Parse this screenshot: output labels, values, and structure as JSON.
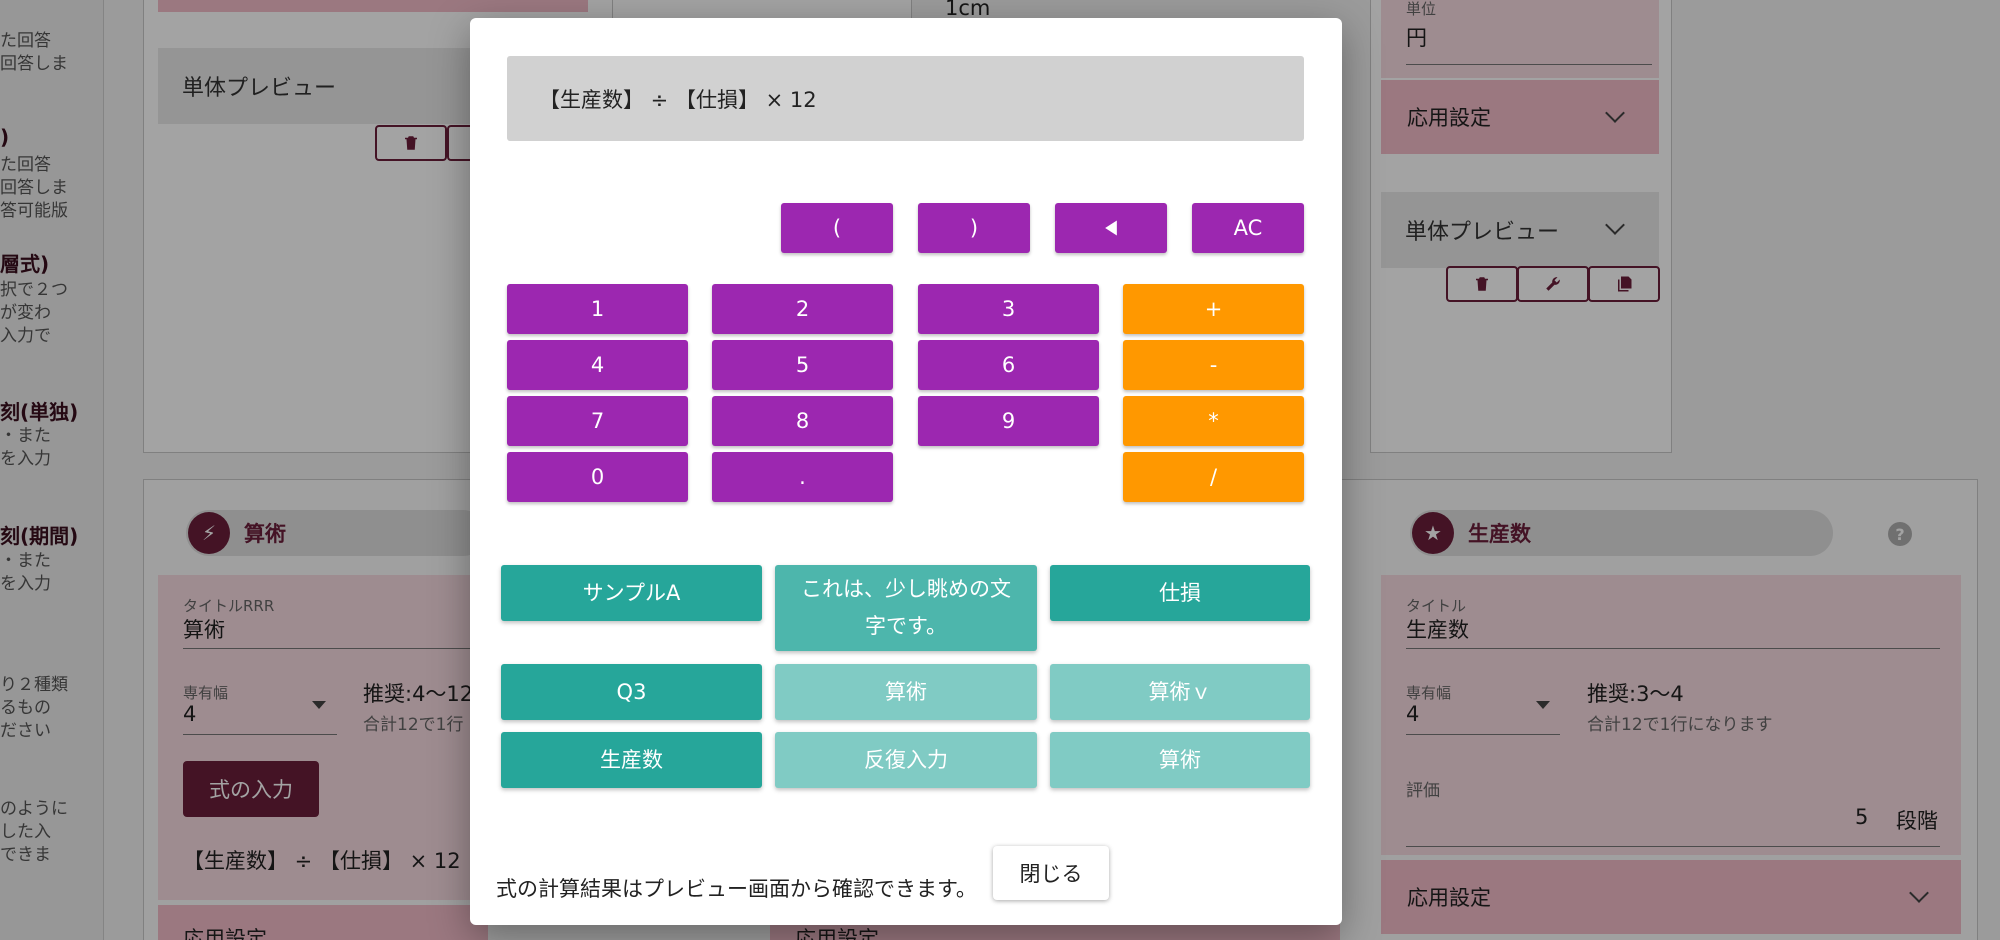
{
  "background": {
    "left_column": {
      "items": [
        {
          "line1": "た回答",
          "line2": "回答しま"
        },
        {
          "title": ")",
          "line1": "た回答",
          "line2": "回答しま",
          "line3": "答可能版"
        },
        {
          "title": "層式)",
          "line1": "択で２つ",
          "line2": "が変わ",
          "line3": "入力で"
        },
        {
          "title": "刻(単独)",
          "line1": "・また",
          "line2": "を入力"
        },
        {
          "title": "刻(期間)",
          "line1": "・また",
          "line2": "を入力"
        },
        {
          "line1": "り２種類",
          "line2": "るもの",
          "line3": "ださい"
        },
        {
          "line1": "のように",
          "line2": "した入",
          "line3": "できま"
        }
      ]
    },
    "top_left_panel": {
      "preview_label": "単体プレビュー"
    },
    "top_mid_panel": {
      "unit_text": "1cm"
    },
    "top_right_panel": {
      "unit_label": "単位",
      "unit_value": "円",
      "advanced_label": "応用設定",
      "preview_label": "単体プレビュー"
    },
    "arith_panel": {
      "header": "算術",
      "title_label": "タイトルRRR",
      "title_value": "算術",
      "width_label": "専有幅",
      "width_value": "4",
      "recommend": "推奨:4〜12",
      "recommend_note": "合計12で1行",
      "formula_button": "式の入力",
      "formula_text": "【生産数】 ÷ 【仕損】 × 12",
      "advanced_label": "応用設定"
    },
    "mid_bottom_panel": {
      "advanced_label": "応用設定"
    },
    "production_panel": {
      "header": "生産数",
      "title_label": "タイトル",
      "title_value": "生産数",
      "width_label": "専有幅",
      "width_value": "4",
      "recommend": "推奨:3〜4",
      "recommend_note": "合計12で1行になります",
      "rating_label": "評価",
      "rating_value": "5",
      "rating_unit": "段階",
      "advanced_label": "応用設定"
    }
  },
  "modal": {
    "display": "【生産数】 ÷ 【仕損】 × 12",
    "control_keys": [
      "(",
      ")",
      "AC"
    ],
    "number_keys": [
      "1",
      "2",
      "3",
      "4",
      "5",
      "6",
      "7",
      "8",
      "9",
      "0",
      "."
    ],
    "operator_keys": [
      "+",
      "-",
      "*",
      "/"
    ],
    "variables": [
      "サンプルA",
      "これは、少し眺めの文字です。",
      "仕損",
      "Q3",
      "算術",
      "算術ｖ",
      "生産数",
      "反復入力",
      "算術"
    ],
    "footer_note": "式の計算結果はプレビュー画面から確認できます。",
    "close_label": "閉じる"
  },
  "colors": {
    "key_purple": "#9c27b0",
    "key_orange": "#ff9800",
    "var_dark": "#26a69a",
    "var_mid": "#4db6ac",
    "var_light": "#80cbc4",
    "brand": "#6b1e3b",
    "pink": "#f3bcc8"
  }
}
